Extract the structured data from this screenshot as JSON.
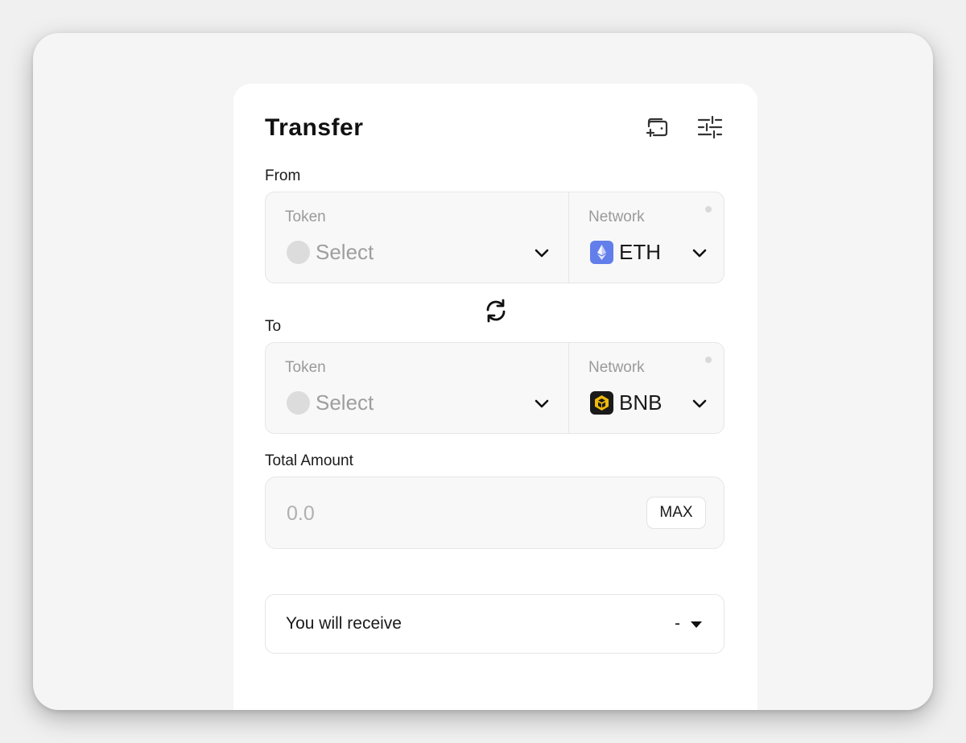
{
  "header": {
    "title": "Transfer",
    "icons": [
      "wallet-add-icon",
      "settings-sliders-icon"
    ]
  },
  "from": {
    "label": "From",
    "token_label": "Token",
    "token_value": "Select",
    "network_label": "Network",
    "network_value": "ETH",
    "network_icon": "eth-icon"
  },
  "swap": {
    "icon": "swap-arrows-icon"
  },
  "to": {
    "label": "To",
    "token_label": "Token",
    "token_value": "Select",
    "network_label": "Network",
    "network_value": "BNB",
    "network_icon": "bnb-icon"
  },
  "amount": {
    "label": "Total Amount",
    "placeholder": "0.0",
    "max_label": "MAX"
  },
  "receive": {
    "label": "You will receive",
    "value": "-"
  },
  "colors": {
    "eth_brand": "#627eea",
    "bnb_brand": "#f0b90b",
    "bnb_bg": "#1a1a1a"
  }
}
